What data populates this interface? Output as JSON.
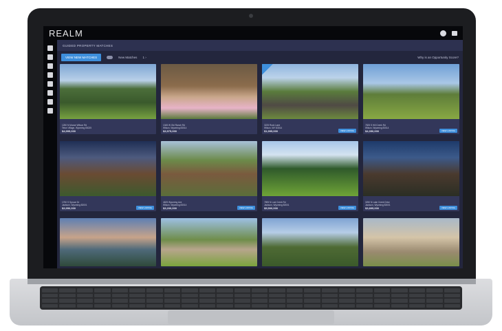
{
  "app": {
    "logo": "REALM"
  },
  "header": {
    "title": "GUIDED PROPERTY MATCHES"
  },
  "controls": {
    "primary_button": "VIEW NEW MATCHES",
    "toggle_label": "New Matches",
    "page_indicator": "1 ›",
    "help_link": "Why is an Opportunity Score?"
  },
  "listings": [
    {
      "address": "1250 N Moose Wilson Rd\nTeton Village, Wyoming 83025",
      "price": "$4,995,000",
      "scene": "sky-mtn",
      "button": ""
    },
    {
      "address": "1345 W Old Ranch Rd\nWilson, Wyoming 83014",
      "price": "$3,975,000",
      "scene": "lodge",
      "button": ""
    },
    {
      "address": "3225 Rock Lane\nWilson, WY 83014",
      "price": "$1,995,000",
      "scene": "creek",
      "button": "VIEW LISTING"
    },
    {
      "address": "7825 S Hill Creek Rd\nWilson, Wyoming 83014",
      "price": "$4,350,000",
      "scene": "meadow",
      "button": "VIEW LISTING"
    },
    {
      "address": "1750 S Spruce Dr\nJackson, Wyoming 83001",
      "price": "$3,950,000",
      "scene": "dusk-house",
      "button": "VIEW LISTING"
    },
    {
      "address": "4625 Wyoming Ave\nWilson, Wyoming 83014",
      "price": "$3,200,000",
      "scene": "log-home",
      "button": "VIEW LISTING"
    },
    {
      "address": "7895 N Lost Creek Rd\nJackson, Wyoming 83001",
      "price": "$5,500,000",
      "scene": "green-field",
      "button": "VIEW LISTING"
    },
    {
      "address": "3250 N Lake Creek Drive\nJackson, Wyoming 83001",
      "price": "$3,895,000",
      "scene": "night-deck",
      "button": "VIEW LISTING"
    },
    {
      "address": "",
      "price": "",
      "scene": "sunset",
      "button": ""
    },
    {
      "address": "",
      "price": "",
      "scene": "drive",
      "button": ""
    },
    {
      "address": "",
      "price": "",
      "scene": "valley",
      "button": ""
    },
    {
      "address": "",
      "price": "",
      "scene": "stone",
      "button": ""
    }
  ]
}
